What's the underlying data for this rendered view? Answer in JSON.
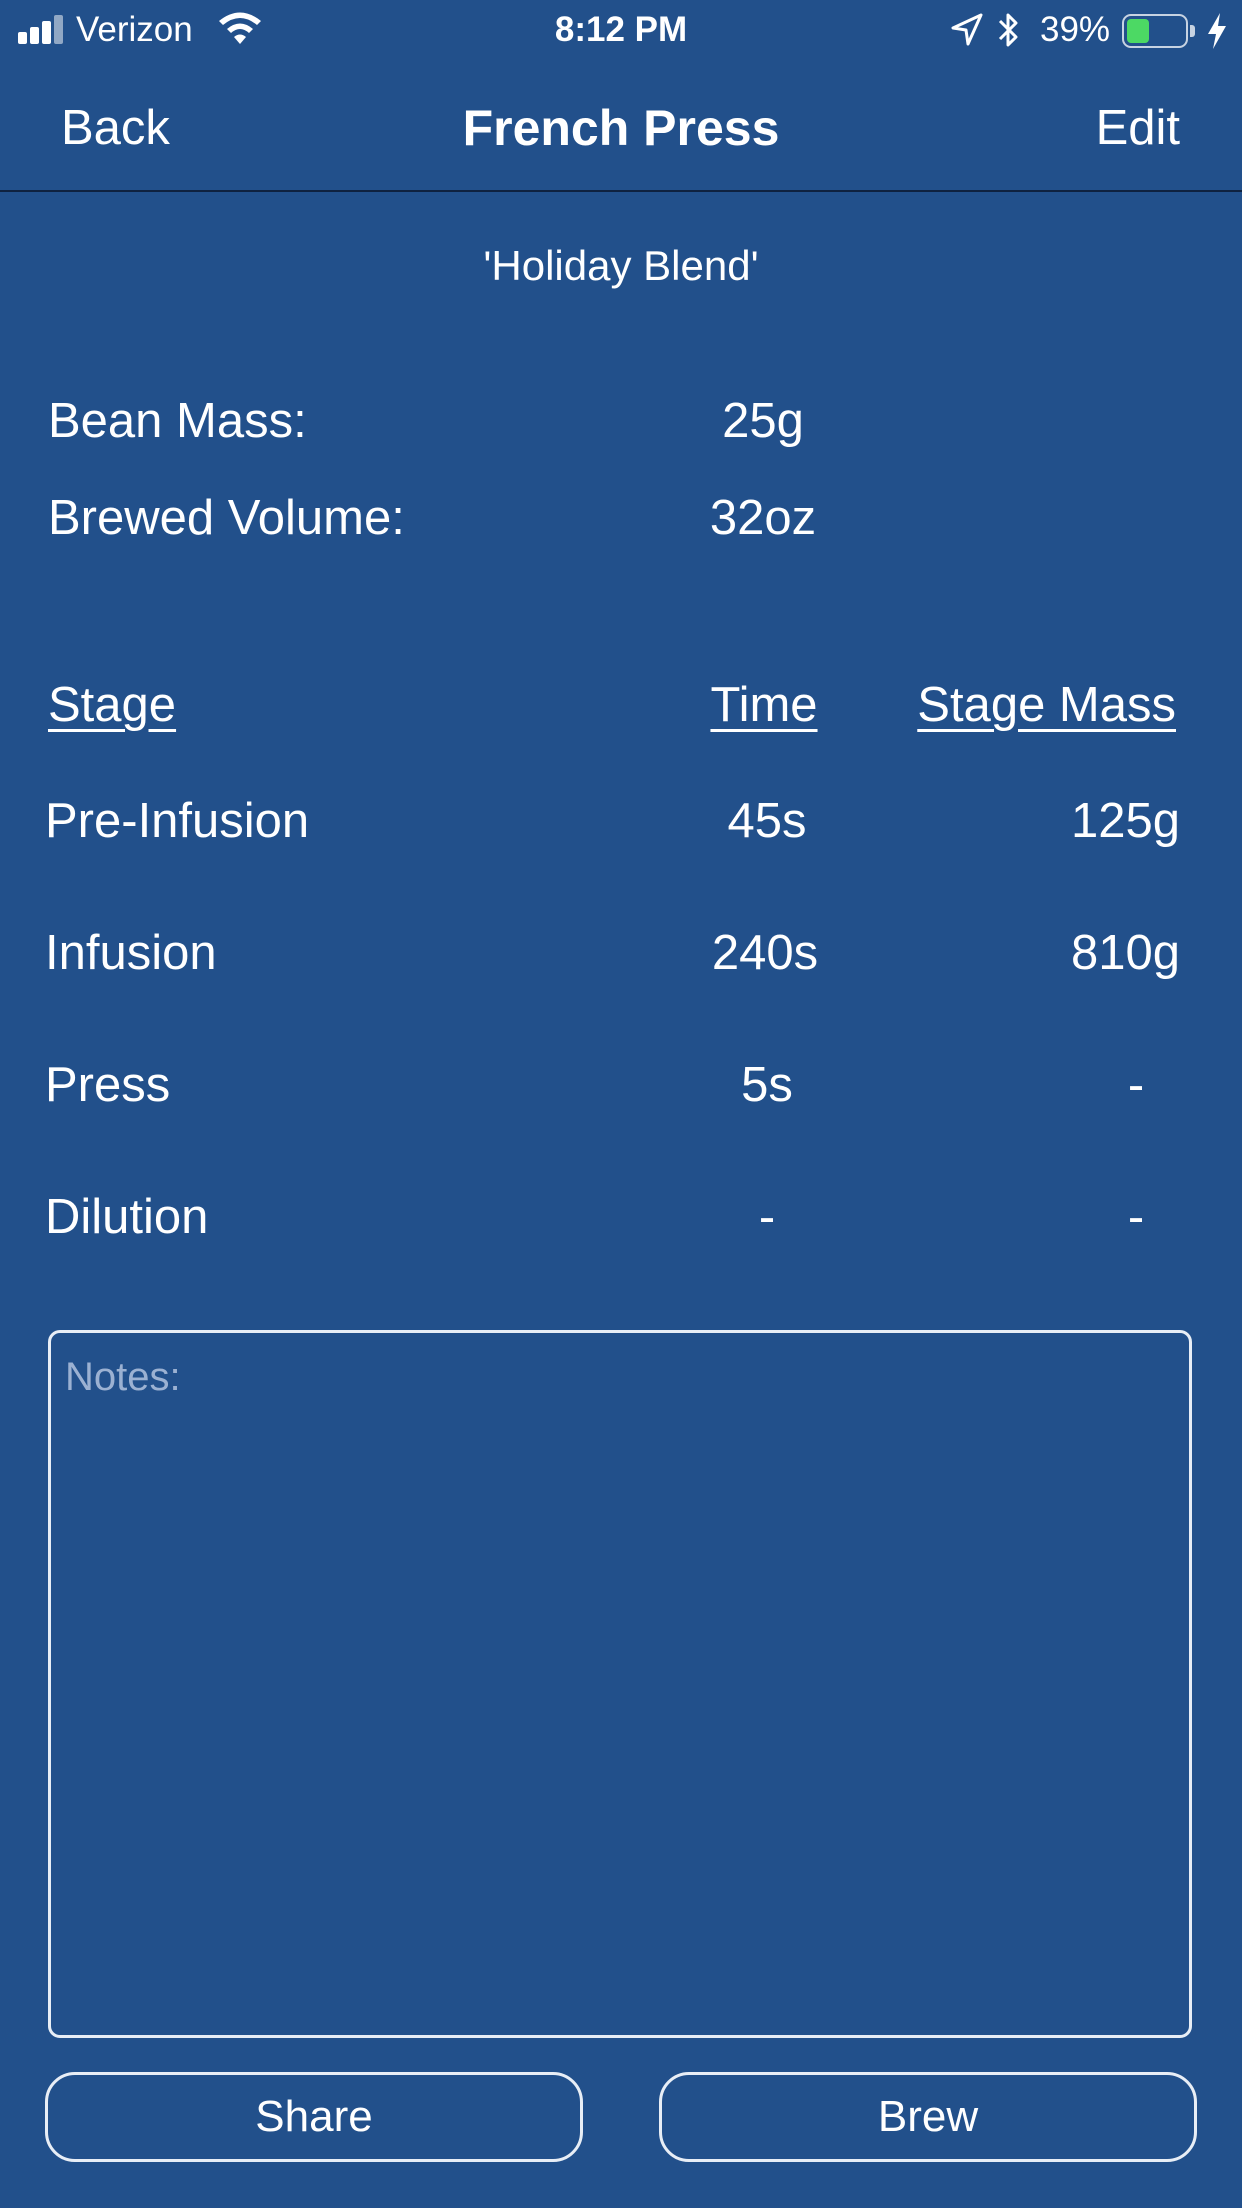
{
  "status_bar": {
    "carrier": "Verizon",
    "time": "8:12 PM",
    "battery_percent": "39%",
    "battery_level": 0.39,
    "icons": [
      "signal-icon",
      "wifi-icon",
      "location-arrow-icon",
      "bluetooth-icon",
      "battery-icon",
      "charging-bolt-icon"
    ]
  },
  "nav": {
    "back_label": "Back",
    "title": "French Press",
    "edit_label": "Edit"
  },
  "recipe": {
    "name": "'Holiday Blend'",
    "bean_mass_label": "Bean Mass:",
    "bean_mass_value": "25g",
    "brewed_volume_label": "Brewed Volume:",
    "brewed_volume_value": "32oz"
  },
  "stages": {
    "headers": {
      "stage": "Stage",
      "time": "Time",
      "mass": "Stage Mass"
    },
    "rows": [
      {
        "stage": "Pre-Infusion",
        "time": "45s",
        "mass": "125g"
      },
      {
        "stage": "Infusion",
        "time": "240s",
        "mass": "810g"
      },
      {
        "stage": "Press",
        "time": "5s",
        "mass": "-"
      },
      {
        "stage": "Dilution",
        "time": "-",
        "mass": "-"
      }
    ]
  },
  "notes": {
    "placeholder": "Notes:"
  },
  "actions": {
    "share_label": "Share",
    "brew_label": "Brew"
  },
  "colors": {
    "background": "#22508b",
    "text": "#ffffff",
    "battery_fill": "#4cd964",
    "placeholder": "#9bb1d2"
  }
}
